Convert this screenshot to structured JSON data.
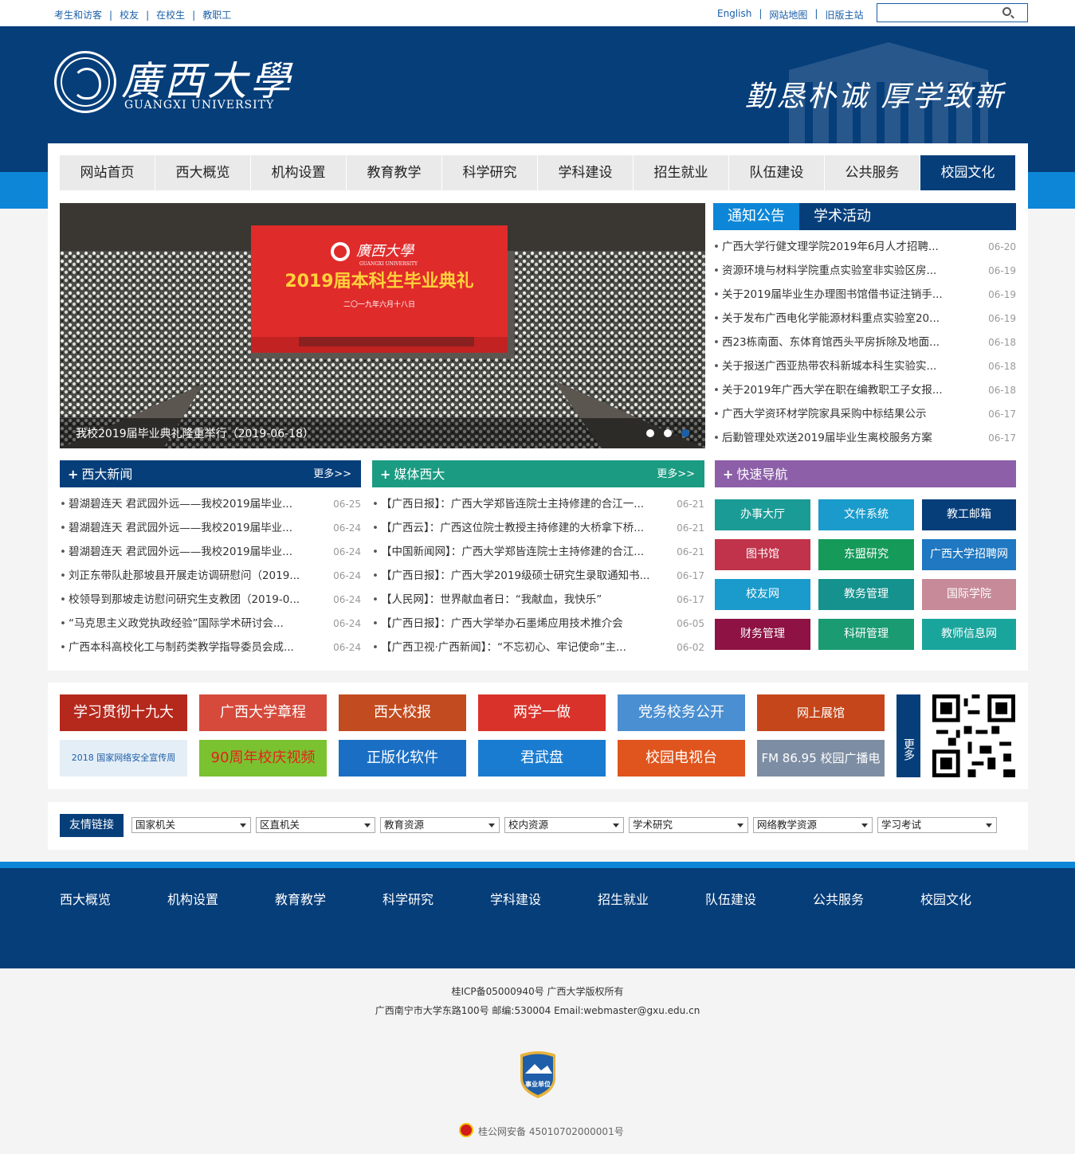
{
  "top": {
    "left_links": [
      "考生和访客",
      "校友",
      "在校生",
      "教职工"
    ],
    "right_links": [
      "English",
      "网站地图",
      "旧版主站"
    ],
    "search_placeholder": ""
  },
  "header": {
    "logo_cn": "廣西大學",
    "logo_en": "GUANGXI UNIVERSITY",
    "motto": "勤恳朴诚  厚学致新"
  },
  "nav": [
    "网站首页",
    "西大概览",
    "机构设置",
    "教育教学",
    "科学研究",
    "学科建设",
    "招生就业",
    "队伍建设",
    "公共服务",
    "校园文化"
  ],
  "slider": {
    "screen_title": "2019届本科生毕业典礼",
    "screen_date": "二〇一九年六月十八日",
    "screen_logo": "廣西大學",
    "screen_logo_en": "GUANGXI UNIVERSITY",
    "caption": "我校2019届毕业典礼隆重举行（2019-06-18）"
  },
  "notice": {
    "tabs": [
      "通知公告",
      "学术活动"
    ],
    "items": [
      {
        "title": "广西大学行健文理学院2019年6月人才招聘...",
        "date": "06-20"
      },
      {
        "title": "资源环境与材料学院重点实验室非实验区房...",
        "date": "06-19"
      },
      {
        "title": "关于2019届毕业生办理图书馆借书证注销手...",
        "date": "06-19"
      },
      {
        "title": "关于发布广西电化学能源材料重点实验室20...",
        "date": "06-19"
      },
      {
        "title": "西23栋南面、东体育馆西头平房拆除及地面...",
        "date": "06-18"
      },
      {
        "title": "关于报送广西亚热带农科新城本科生实验实...",
        "date": "06-18"
      },
      {
        "title": "关于2019年广西大学在职在编教职工子女报...",
        "date": "06-18"
      },
      {
        "title": "广西大学资环材学院家具采购中标结果公示",
        "date": "06-17"
      },
      {
        "title": "后勤管理处欢送2019届毕业生离校服务方案",
        "date": "06-17"
      }
    ]
  },
  "news": {
    "title": "西大新闻",
    "more": "更多>>",
    "items": [
      {
        "title": "碧湖碧连天 君武园外远——我校2019届毕业...",
        "date": "06-25"
      },
      {
        "title": "碧湖碧连天 君武园外远——我校2019届毕业...",
        "date": "06-24"
      },
      {
        "title": "碧湖碧连天 君武园外远——我校2019届毕业...",
        "date": "06-24"
      },
      {
        "title": "刘正东带队赴那坡县开展走访调研慰问（2019...",
        "date": "06-24"
      },
      {
        "title": "校领导到那坡走访慰问研究生支教团（2019-0...",
        "date": "06-24"
      },
      {
        "title": "“马克思主义政党执政经验”国际学术研讨会...",
        "date": "06-24"
      },
      {
        "title": "广西本科高校化工与制药类教学指导委员会成...",
        "date": "06-24"
      }
    ]
  },
  "media": {
    "title": "媒体西大",
    "more": "更多>>",
    "items": [
      {
        "title": "【广西日报】：广西大学郑皆连院士主持修建的合江一...",
        "date": "06-21"
      },
      {
        "title": "【广西云】：广西这位院士教授主持修建的大桥拿下桥...",
        "date": "06-21"
      },
      {
        "title": "【中国新闻网】：广西大学郑皆连院士主持修建的合江...",
        "date": "06-21"
      },
      {
        "title": "【广西日报】：广西大学2019级硕士研究生录取通知书...",
        "date": "06-17"
      },
      {
        "title": "【人民网】：世界献血者日：“我献血，我快乐”",
        "date": "06-17"
      },
      {
        "title": "【广西日报】：广西大学举办石墨烯应用技术推介会",
        "date": "06-05"
      },
      {
        "title": "【广西卫视·广西新闻】：“不忘初心、牢记使命”主...",
        "date": "06-02"
      }
    ]
  },
  "quick": {
    "title": "快速导航",
    "items": [
      {
        "label": "办事大厅",
        "color": "#1a9b96"
      },
      {
        "label": "文件系统",
        "color": "#1a9bcc"
      },
      {
        "label": "教工邮箱",
        "color": "#063e7a"
      },
      {
        "label": "图书馆",
        "color": "#c0334a"
      },
      {
        "label": "东盟研究",
        "color": "#159a5a"
      },
      {
        "label": "广西大学招聘网",
        "color": "#1f78c1"
      },
      {
        "label": "校友网",
        "color": "#1a9bcc"
      },
      {
        "label": "教务管理",
        "color": "#15928e"
      },
      {
        "label": "国际学院",
        "color": "#c68a98"
      },
      {
        "label": "财务管理",
        "color": "#8e1244"
      },
      {
        "label": "科研管理",
        "color": "#1a9b72"
      },
      {
        "label": "教师信息网",
        "color": "#1aa59c"
      }
    ]
  },
  "banners": [
    {
      "label": "学习贯彻十九大",
      "color": "#b5291d"
    },
    {
      "label": "广西大学章程",
      "color": "#d54a3b"
    },
    {
      "label": "西大校报",
      "color": "#c24b1f"
    },
    {
      "label": "两学一做",
      "color": "#d9322a"
    },
    {
      "label": "党务校务公开",
      "color": "#4a8fd1"
    },
    {
      "label": "网上展馆",
      "color": "#c5461a"
    },
    {
      "label": "2018 国家网络安全宣传周",
      "color": "#e4eef7"
    },
    {
      "label": "90周年校庆视频",
      "color": "#7bc231"
    },
    {
      "label": "正版化软件",
      "color": "#1a6fc4"
    },
    {
      "label": "君武盘",
      "color": "#1a7cd0"
    },
    {
      "label": "校园电视台",
      "color": "#e0541d"
    },
    {
      "label": "FM 86.95 校园广播电台",
      "color": "#7d8ea4"
    }
  ],
  "more_vertical": "更多",
  "friend_links": {
    "label": "友情链接",
    "selects": [
      "国家机关",
      "区直机关",
      "教育资源",
      "校内资源",
      "学术研究",
      "网络教学资源",
      "学习考试"
    ]
  },
  "footer_nav": [
    "西大概览",
    "机构设置",
    "教育教学",
    "科学研究",
    "学科建设",
    "招生就业",
    "队伍建设",
    "公共服务",
    "校园文化"
  ],
  "copyright": {
    "line1": "桂ICP备05000940号 广西大学版权所有",
    "line2": "广西南宁市大学东路100号 邮编:530004 Email:webmaster@gxu.edu.cn",
    "badge": "事业单位",
    "police": "桂公网安备 45010702000001号"
  }
}
